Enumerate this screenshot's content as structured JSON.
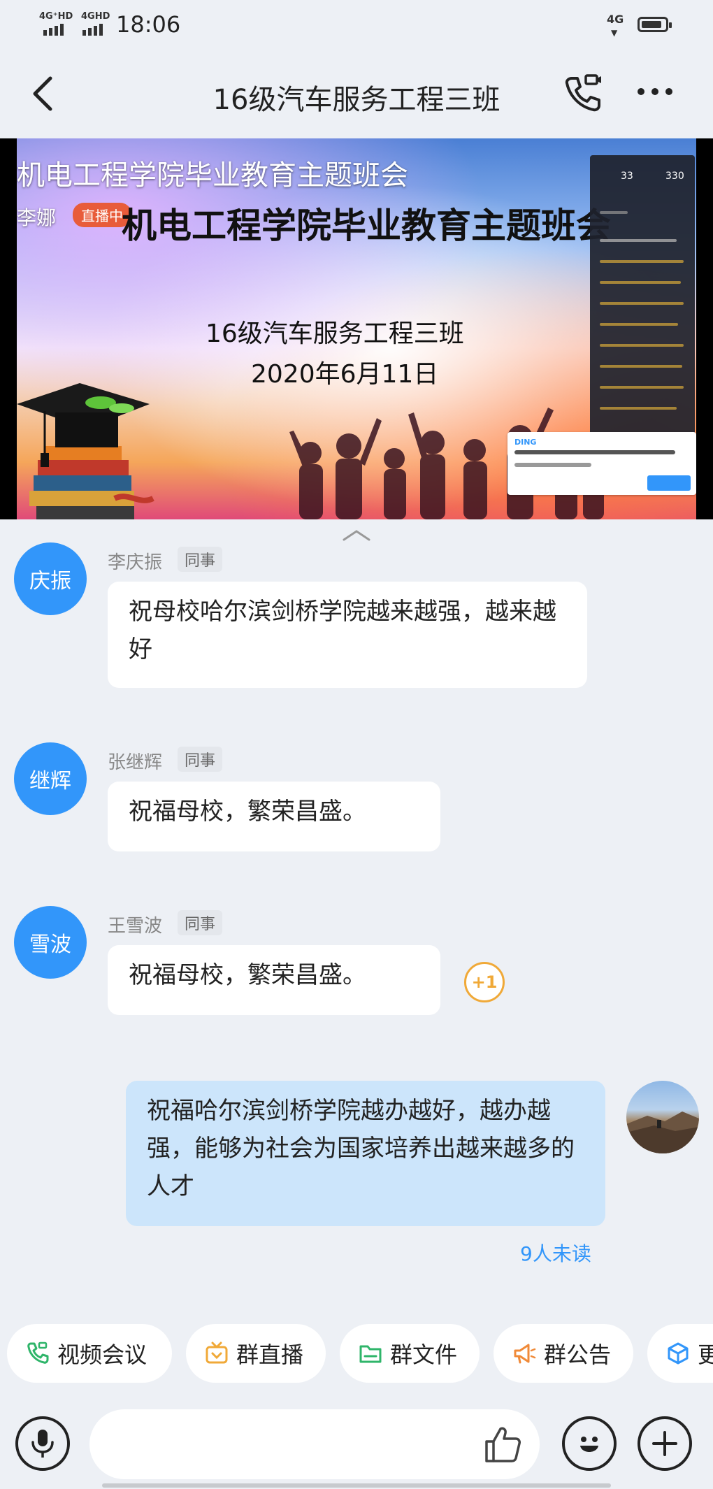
{
  "status_bar": {
    "sim1": "4G⁺HD",
    "sim2": "4GHD",
    "time": "18:06",
    "net_right": "4G"
  },
  "header": {
    "title": "16级汽车服务工程三班"
  },
  "live": {
    "caption": "机电工程学院毕业教育主题班会",
    "presenter": "李娜",
    "badge": "直播中",
    "slide_title": "机电工程学院毕业教育主题班会",
    "slide_subtitle": "16级汽车服务工程三班",
    "slide_date": "2020年6月11日",
    "panel": {
      "count_a": "33",
      "count_b": "330"
    },
    "ding_label": "DING"
  },
  "messages": [
    {
      "avatar": "庆振",
      "sender": "李庆振",
      "tag": "同事",
      "text": "祝母校哈尔滨剑桥学院越来越强，越来越好"
    },
    {
      "avatar": "继辉",
      "sender": "张继辉",
      "tag": "同事",
      "text": "祝福母校，繁荣昌盛。"
    },
    {
      "avatar": "雪波",
      "sender": "王雪波",
      "tag": "同事",
      "text": "祝福母校，繁荣昌盛。",
      "reaction": "+1"
    },
    {
      "mine": true,
      "text": "祝福哈尔滨剑桥学院越办越好，越办越强，能够为社会为国家培养出越来越多的人才",
      "status": "9人未读"
    }
  ],
  "quick_actions": [
    {
      "label": "视频会议",
      "icon": "video-call-icon",
      "color": "#2fb56a"
    },
    {
      "label": "群直播",
      "icon": "live-tv-icon",
      "color": "#f0a938"
    },
    {
      "label": "群文件",
      "icon": "folder-icon",
      "color": "#2fb56a"
    },
    {
      "label": "群公告",
      "icon": "megaphone-icon",
      "color": "#f08a38"
    },
    {
      "label": "更",
      "icon": "cube-icon",
      "color": "#3296fa"
    }
  ],
  "input": {
    "placeholder": ""
  },
  "colors": {
    "accent": "#3296fa",
    "live_badge": "#e85c3a",
    "my_bubble": "#cce5fb"
  }
}
